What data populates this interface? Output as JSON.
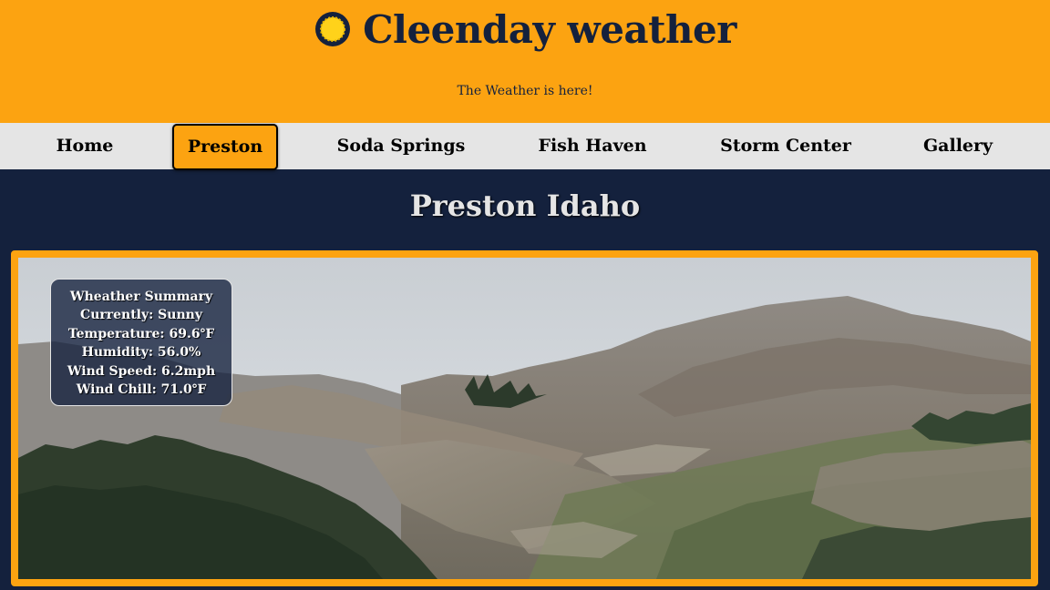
{
  "header": {
    "logo_icon": "sun-icon",
    "title": "Cleenday weather",
    "tagline": "The Weather is here!"
  },
  "nav": {
    "items": [
      "Home",
      "Preston",
      "Soda Springs",
      "Fish Haven",
      "Storm Center",
      "Gallery"
    ],
    "active": "Preston"
  },
  "main": {
    "heading": "Preston Idaho",
    "hero_image": "mountain-photo"
  },
  "summary": {
    "title": "Wheather Summary",
    "currently": "Currently: Sunny",
    "temperature": "Temperature: 69.6℉",
    "humidity": "Humidity: 56.0%",
    "wind_speed": "Wind Speed: 6.2mph",
    "wind_chill": "Wind Chill: 71.0℉"
  },
  "colors": {
    "accent": "#fca311",
    "navy": "#14213d",
    "nav_bg": "#e5e5e5"
  }
}
